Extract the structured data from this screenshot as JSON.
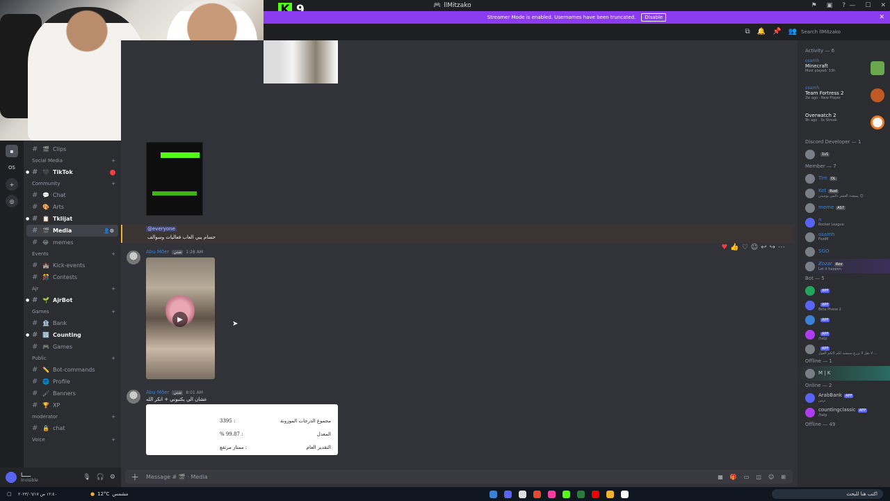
{
  "overlay": {
    "kick_count": "9"
  },
  "window": {
    "title": "llMitzako"
  },
  "banner": {
    "text": "Streamer Mode is enabled. Usernames have been truncated.",
    "disable": "Disable"
  },
  "header": {
    "search_placeholder": "Search llMitzako"
  },
  "servers": {
    "label": "OS"
  },
  "channels": {
    "clips": "Clips",
    "cat_social": "Social Media",
    "tiktok": "TikTok",
    "cat_community": "Community",
    "chat": "Chat",
    "arts": "Arts",
    "tklijat": "Tklijat",
    "media": "Media",
    "memes": "memes",
    "cat_events": "Events",
    "kick_events": "Kick-events",
    "contests": "Contests",
    "cat_ajr": "Ajr",
    "ajrbot": "AjrBot",
    "cat_games": "Games",
    "bank": "Bank",
    "counting": "Counting",
    "games": "Games",
    "cat_public": "Public",
    "bot_commands": "Bot-commands",
    "profile": "Profile",
    "banners": "Banners",
    "xp": "XP",
    "cat_moderator": "moderator",
    "chat2": "chat",
    "cat_voice": "Voice"
  },
  "user": {
    "name": "ـــــا",
    "status": "Invisible"
  },
  "messages": {
    "mention": "@everyone",
    "mention_text": "حسام يبي العاب فعاليات وسوالف",
    "author1": "Abu Môer",
    "tag1": "شتي",
    "time1": "1:28 AM",
    "author2": "Abu Môer",
    "tag2": "شتي",
    "time2": "8:01 AM",
    "msg2": "عشان الي يكتبوني + انكر الله",
    "grades": [
      {
        "label": "مجموع الدرجات الموزونة",
        "value": ": 3395"
      },
      {
        "label": "المعدل",
        "value": ": 99.87 %"
      },
      {
        "label": "التقدير العام",
        "value": ": ممتاز مرتفع"
      }
    ]
  },
  "composer": {
    "placeholder": "Message # 🎬 · Media"
  },
  "members": {
    "activity_header": "Activity — 6",
    "activities": [
      {
        "who": "osamh",
        "game": "Minecraft",
        "sub": "Most played: 33h",
        "color": "#6aa84f"
      },
      {
        "who": "osamh",
        "game": "Team Fortress 2",
        "sub": "2w ago · New Player",
        "color": "#c05a24"
      },
      {
        "who": "",
        "game": "Overwatch 2",
        "sub": "9h ago · 3x Streak",
        "color": "#f7f7f7"
      }
    ],
    "dev_header": "Discord Developer — 1",
    "dev_member": {
      "badge": "1v1"
    },
    "member_header": "Member — 7",
    "members_list": [
      {
        "name": "Tim",
        "status": "",
        "tag": "OL",
        "color": "#3b82d6"
      },
      {
        "name": "Kot",
        "status": "يسعده العشر دائمي بوجيدن 😏",
        "tag": "Ruel",
        "color": "#3b82d6"
      },
      {
        "name": "meme",
        "status": "",
        "tag": "AS7",
        "color": "#3b82d6"
      },
      {
        "name": "n",
        "status": "Rocket League",
        "tag": "",
        "color": "#3b82d6"
      },
      {
        "name": "osamh",
        "status": "FiveM",
        "tag": "",
        "color": "#3b82d6"
      },
      {
        "name": "SGO",
        "status": "",
        "tag": "",
        "color": "#3b82d6"
      },
      {
        "name": "Ƶoᴢar",
        "status": "Let it happen",
        "tag": "Rev",
        "color": "#3b82d6"
      }
    ],
    "bot_header": "Bot — 5",
    "bots": [
      {
        "name": "",
        "status": "",
        "tag": "APP",
        "color": "#23a559"
      },
      {
        "name": "",
        "status": "Beta Phase 2",
        "tag": "APP",
        "color": "#5865f2"
      },
      {
        "name": "",
        "status": "",
        "tag": "APP",
        "color": "#3b82d6"
      },
      {
        "name": "",
        "status": "/help",
        "tag": "APP",
        "color": "#b03cf0"
      },
      {
        "name": "",
        "status": "لا تقل لا يزرع سيشبه لكم لائكم القول ...",
        "tag": "APP",
        "color": "#3b82d6"
      }
    ],
    "offline1_header": "Offline — 1",
    "offline1": {
      "name": "M | K"
    },
    "online2_header": "Online — 2",
    "online2": [
      {
        "name": "ArabBank",
        "status": "ترس",
        "tag": "APP"
      },
      {
        "name": "countingclassic",
        "status": "/help",
        "tag": "APP"
      }
    ],
    "offline49_header": "Offline — 49"
  },
  "taskbar": {
    "temp": "12°C",
    "weather": "مشمس",
    "search": "اكتب هنا للبحث",
    "clock": "١٢:٤٠ ص\n٢٠٢٣/٠٦/١٧"
  }
}
